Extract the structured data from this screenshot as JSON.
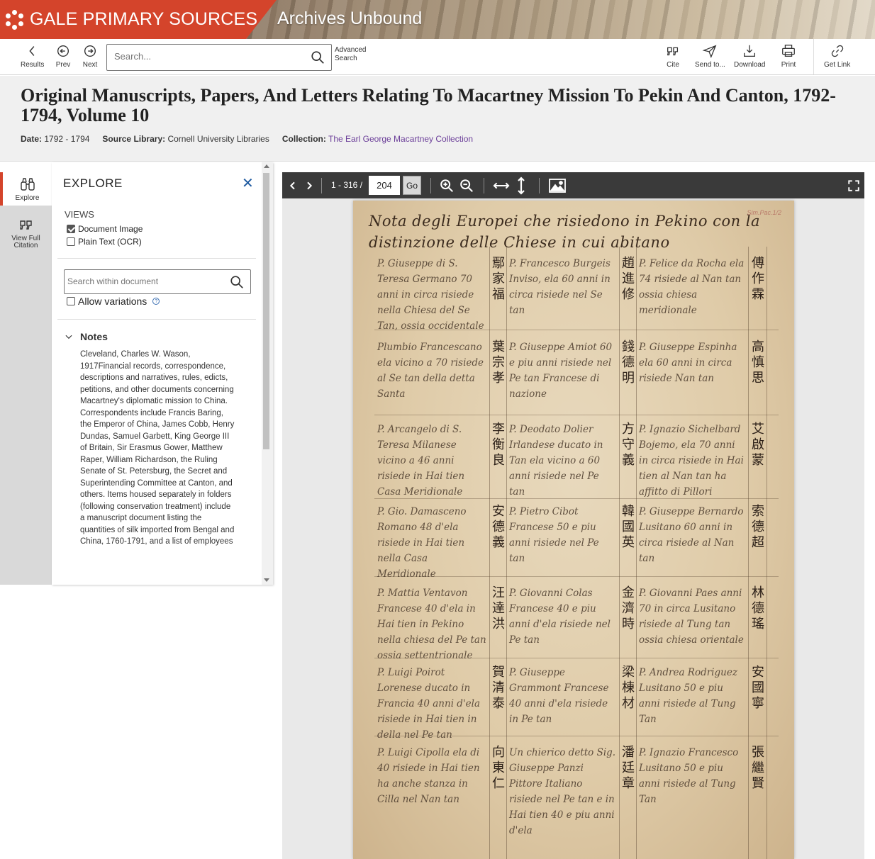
{
  "banner": {
    "brand": "GALE PRIMARY SOURCES",
    "product": "Archives Unbound",
    "brand_color": "#d4442b"
  },
  "toolbar": {
    "results_label": "Results",
    "prev_label": "Prev",
    "next_label": "Next",
    "search_placeholder": "Search...",
    "advanced_search_label": "Advanced Search",
    "cite_label": "Cite",
    "send_label": "Send to...",
    "download_label": "Download",
    "print_label": "Print",
    "get_link_label": "Get Link"
  },
  "document": {
    "title": "Original Manuscripts, Papers, And Letters Relating To Macartney Mission To Pekin And Canton, 1792-1794, Volume 10",
    "date_label": "Date:",
    "date_value": "1792 - 1794",
    "source_label": "Source Library:",
    "source_value": "Cornell University Libraries",
    "collection_label": "Collection:",
    "collection_value": "The Earl George Macartney Collection"
  },
  "rail": {
    "explore_label": "Explore",
    "citation_label": "View Full Citation"
  },
  "explore": {
    "title": "EXPLORE",
    "views_label": "VIEWS",
    "views": [
      {
        "label": "Document Image",
        "checked": true
      },
      {
        "label": "Plain Text (OCR)",
        "checked": false
      }
    ],
    "search_placeholder": "Search within document",
    "allow_variations_label": "Allow variations",
    "notes_title": "Notes",
    "notes_text": "Cleveland, Charles W. Wason, 1917Financial records, correspondence, descriptions and narratives, rules, edicts, petitions, and other documents concerning Macartney's diplomatic mission to China. Correspondents include Francis Baring, the Emperor of China, James Cobb, Henry Dundas, Samuel Garbett, King George III of Britain, Sir Erasmus Gower, Matthew Raper, William Richardson, the Ruling Senate of St. Petersburg, the Secret and Superintending Committee at Canton, and others. Items housed separately in folders (following conservation treatment) include a manuscript document listing the quantities of silk imported from Bengal and China, 1760-1791, and a list of employees"
  },
  "viewer": {
    "page_range": "1 - 316 /",
    "current_page": "204",
    "go_label": "Go"
  },
  "manuscript": {
    "heading": "Nota degli Europei che risiedono in Pekino con la distinzione delle Chiese in cui abitano",
    "stamp": "Sim.Pac.1/2",
    "rows": [
      {
        "col1": "P. Giuseppe di S. Teresa Germano 70 anni in circa risiede nella Chiesa del Se Tan, ossia occidentale",
        "cjk1": "鄢家福",
        "col2": "P. Francesco Burgeis Inviso, ela 60 anni in circa risiede nel Se tan",
        "cjk2": "趙進修",
        "col3": "P. Felice da Rocha ela 74 risiede al Nan tan ossia chiesa meridionale",
        "cjk3": "傅作霖"
      },
      {
        "col1": "Plumbio Francescano ela vicino a 70 risiede al Se tan della detta Santa",
        "cjk1": "葉宗孝",
        "col2": "P. Giuseppe Amiot 60 e piu anni risiede nel Pe tan Francese di nazione",
        "cjk2": "錢德明",
        "col3": "P. Giuseppe Espinha ela 60 anni in circa risiede Nan tan",
        "cjk3": "高慎思"
      },
      {
        "col1": "P. Arcangelo di S. Teresa Milanese vicino a 46 anni risiede in Hai tien Casa Meridionale",
        "cjk1": "李衡良",
        "col2": "P. Deodato Dolier Irlandese ducato in Tan ela vicino a 60 anni risiede nel Pe tan",
        "cjk2": "方守義",
        "col3": "P. Ignazio Sichelbard Bojemo, ela 70 anni in circa risiede in Hai tien al Nan tan ha affitto di Pillori",
        "cjk3": "艾啟蒙"
      },
      {
        "col1": "P. Gio. Damasceno Romano 48 d'ela risiede in Hai tien nella Casa Meridionale",
        "cjk1": "安德義",
        "col2": "P. Pietro Cibot Francese 50 e piu anni risiede nel Pe tan",
        "cjk2": "韓國英",
        "col3": "P. Giuseppe Bernardo Lusitano 60 anni in circa risiede al Nan tan",
        "cjk3": "索德超"
      },
      {
        "col1": "P. Mattia Ventavon Francese 40 d'ela in Hai tien in Pekino nella chiesa del Pe tan ossia settentrionale",
        "cjk1": "汪達洪",
        "col2": "P. Giovanni Colas Francese 40 e piu anni d'ela risiede nel Pe tan",
        "cjk2": "金濟時",
        "col3": "P. Giovanni Paes anni 70 in circa Lusitano risiede al Tung tan ossia chiesa orientale",
        "cjk3": "林德瑤"
      },
      {
        "col1": "P. Luigi Poirot Lorenese ducato in Francia 40 anni d'ela risiede in Hai tien in della nel Pe tan",
        "cjk1": "賀清泰",
        "col2": "P. Giuseppe Grammont Francese 40 anni d'ela risiede in Pe tan",
        "cjk2": "梁棟材",
        "col3": "P. Andrea Rodriguez Lusitano 50 e piu anni risiede al Tung Tan",
        "cjk3": "安國寧"
      },
      {
        "col1": "P. Luigi Cipolla ela di 40 risiede in Hai tien ha anche stanza in Cilla nel Nan tan",
        "cjk1": "向東仁",
        "col2": "Un chierico detto Sig. Giuseppe Panzi Pittore Italiano risiede nel Pe tan e in Hai tien 40 e piu anni d'ela",
        "cjk2": "潘廷章",
        "col3": "P. Ignazio Francesco Lusitano 50 e piu anni risiede al Tung Tan",
        "cjk3": "張繼賢"
      }
    ]
  }
}
